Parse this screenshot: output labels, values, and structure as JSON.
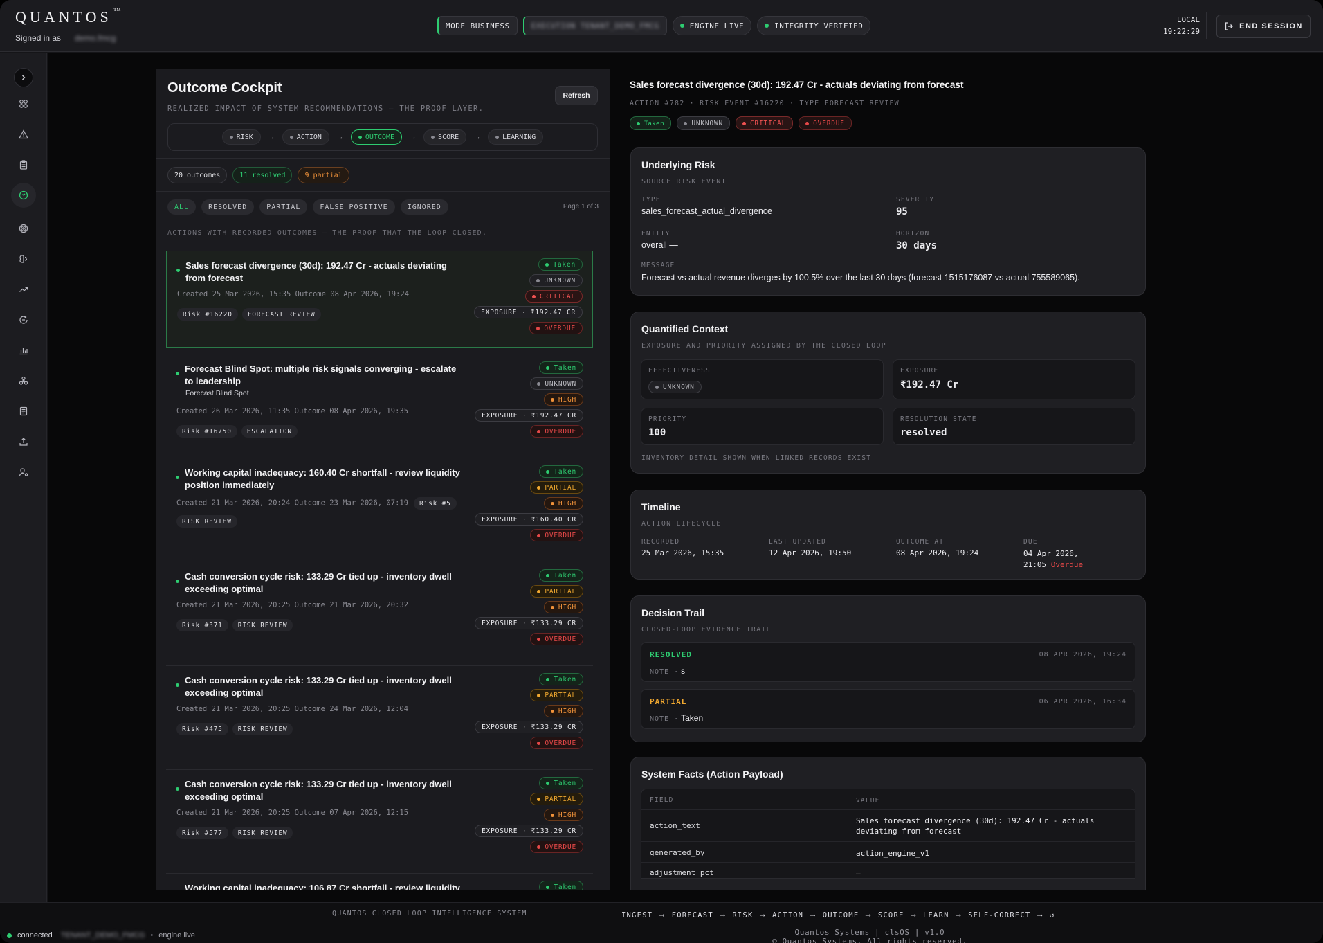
{
  "header": {
    "brand": "QUANTOS",
    "trademark": "™",
    "signed_in_label": "Signed in as",
    "user": "demo.fmcg",
    "pills": [
      "MODE BUSINESS",
      "EXECUTION TENANT_DEMO_FMCG",
      "ENGINE LIVE",
      "INTEGRITY VERIFIED"
    ],
    "local_label": "LOCAL",
    "time": "19:22:29",
    "end_session": "END SESSION"
  },
  "sidebar": {
    "icons": [
      "chevron-right-icon",
      "grid-icon",
      "alert-triangle-icon",
      "clipboard-icon",
      "clock-icon",
      "target-icon",
      "brain-icon",
      "trending-up-icon",
      "refresh-cycle-icon",
      "bar-chart-icon",
      "network-icon",
      "document-icon",
      "upload-icon",
      "user-settings-icon"
    ],
    "active_index": 4
  },
  "cockpit": {
    "title": "Outcome Cockpit",
    "subtitle": "REALIZED IMPACT OF SYSTEM RECOMMENDATIONS — THE PROOF LAYER.",
    "refresh": "Refresh",
    "flow": [
      "RISK",
      "ACTION",
      "OUTCOME",
      "SCORE",
      "LEARNING"
    ],
    "flow_active": "OUTCOME",
    "counts": {
      "total": "20 outcomes",
      "resolved": "11 resolved",
      "partial": "9 partial"
    },
    "filters": [
      "ALL",
      "RESOLVED",
      "PARTIAL",
      "FALSE POSITIVE",
      "IGNORED"
    ],
    "active_filter": "ALL",
    "page": "Page 1 of 3",
    "hint": "ACTIONS WITH RECORDED OUTCOMES — THE PROOF THAT THE LOOP CLOSED."
  },
  "cards": [
    {
      "title": "Sales forecast divergence (30d): 192.47 Cr - actuals deviating from forecast",
      "subtitle": "",
      "meta": "Created 25 Mar 2026, 15:35 Outcome 08 Apr 2026, 19:24",
      "tags": [
        "Risk #16220",
        "FORECAST REVIEW"
      ],
      "status": "Taken",
      "effect": "UNKNOWN",
      "effect_kind": "unk",
      "severity": "CRITICAL",
      "severity_kind": "crit",
      "exposure": "EXPOSURE · ₹192.47 CR",
      "due": "OVERDUE"
    },
    {
      "title": "Forecast Blind Spot: multiple risk signals converging - escalate to leadership",
      "subtitle": "Forecast Blind Spot",
      "meta": "Created 26 Mar 2026, 11:35 Outcome 08 Apr 2026, 19:35",
      "tags": [
        "Risk #16750",
        "ESCALATION"
      ],
      "status": "Taken",
      "effect": "UNKNOWN",
      "effect_kind": "unk",
      "severity": "HIGH",
      "severity_kind": "high",
      "exposure": "EXPOSURE · ₹192.47 CR",
      "due": "OVERDUE"
    },
    {
      "title": "Working capital inadequacy: 160.40 Cr shortfall - review liquidity position immediately",
      "subtitle": "",
      "meta": "Created 21 Mar 2026, 20:24 Outcome 23 Mar 2026, 07:19",
      "meta_tag": "Risk #5",
      "tags": [
        "RISK REVIEW"
      ],
      "status": "Taken",
      "effect": "PARTIAL",
      "effect_kind": "part",
      "severity": "HIGH",
      "severity_kind": "high",
      "exposure": "EXPOSURE · ₹160.40 CR",
      "due": "OVERDUE"
    },
    {
      "title": "Cash conversion cycle risk: 133.29 Cr tied up - inventory dwell exceeding optimal",
      "subtitle": "",
      "meta": "Created 21 Mar 2026, 20:25 Outcome 21 Mar 2026, 20:32",
      "tags": [
        "Risk #371",
        "RISK REVIEW"
      ],
      "status": "Taken",
      "effect": "PARTIAL",
      "effect_kind": "part",
      "severity": "HIGH",
      "severity_kind": "high",
      "exposure": "EXPOSURE · ₹133.29 CR",
      "due": "OVERDUE"
    },
    {
      "title": "Cash conversion cycle risk: 133.29 Cr tied up - inventory dwell exceeding optimal",
      "subtitle": "",
      "meta": "Created 21 Mar 2026, 20:25 Outcome 24 Mar 2026, 12:04",
      "tags": [
        "Risk #475",
        "RISK REVIEW"
      ],
      "status": "Taken",
      "effect": "PARTIAL",
      "effect_kind": "part",
      "severity": "HIGH",
      "severity_kind": "high",
      "exposure": "EXPOSURE · ₹133.29 CR",
      "due": "OVERDUE"
    },
    {
      "title": "Cash conversion cycle risk: 133.29 Cr tied up - inventory dwell exceeding optimal",
      "subtitle": "",
      "meta": "Created 21 Mar 2026, 20:25 Outcome 07 Apr 2026, 12:15",
      "tags": [
        "Risk #577",
        "RISK REVIEW"
      ],
      "status": "Taken",
      "effect": "PARTIAL",
      "effect_kind": "part",
      "severity": "HIGH",
      "severity_kind": "high",
      "exposure": "EXPOSURE · ₹133.29 CR",
      "due": "OVERDUE"
    },
    {
      "title": "Working capital inadequacy: 106.87 Cr shortfall - review liquidity",
      "subtitle": "",
      "meta": "",
      "tags": [],
      "status": "Taken",
      "effect": "",
      "effect_kind": "",
      "severity": "",
      "severity_kind": "",
      "exposure": "",
      "due": ""
    }
  ],
  "detail": {
    "title": "Sales forecast divergence (30d): 192.47 Cr - actuals deviating from forecast",
    "meta": "ACTION #782 · RISK EVENT #16220 · TYPE FORECAST_REVIEW",
    "badges": {
      "status": "Taken",
      "effect": "UNKNOWN",
      "severity": "CRITICAL",
      "due": "OVERDUE"
    },
    "risk": {
      "title": "Underlying Risk",
      "subtitle": "SOURCE RISK EVENT",
      "type_label": "TYPE",
      "type": "sales_forecast_actual_divergence",
      "severity_label": "SEVERITY",
      "severity": "95",
      "entity_label": "ENTITY",
      "entity": "overall —",
      "horizon_label": "HORIZON",
      "horizon": "30 days",
      "message_label": "MESSAGE",
      "message": "Forecast vs actual revenue diverges by 100.5% over the last 30 days (forecast 1515176087 vs actual 755589065)."
    },
    "context": {
      "title": "Quantified Context",
      "subtitle": "EXPOSURE AND PRIORITY ASSIGNED BY THE CLOSED LOOP",
      "effectiveness_label": "EFFECTIVENESS",
      "effectiveness": "UNKNOWN",
      "exposure_label": "EXPOSURE",
      "exposure": "₹192.47 Cr",
      "priority_label": "PRIORITY",
      "priority": "100",
      "resolution_label": "RESOLUTION STATE",
      "resolution": "resolved",
      "note": "INVENTORY DETAIL SHOWN WHEN LINKED RECORDS EXIST"
    },
    "timeline": {
      "title": "Timeline",
      "subtitle": "ACTION LIFECYCLE",
      "recorded_label": "RECORDED",
      "recorded": "25 Mar 2026, 15:35",
      "updated_label": "LAST UPDATED",
      "updated": "12 Apr 2026, 19:50",
      "outcome_label": "OUTCOME AT",
      "outcome": "08 Apr 2026, 19:24",
      "due_label": "DUE",
      "due_line1": "04 Apr 2026,",
      "due_line2": "21:05",
      "due_flag": "Overdue"
    },
    "trail": {
      "title": "Decision Trail",
      "subtitle": "CLOSED-LOOP EVIDENCE TRAIL",
      "entries": [
        {
          "state": "RESOLVED",
          "date": "08 APR 2026, 19:24",
          "note_label": "NOTE ·",
          "note": "s"
        },
        {
          "state": "PARTIAL",
          "date": "06 APR 2026, 16:34",
          "note_label": "NOTE ·",
          "note": "Taken"
        }
      ]
    },
    "facts": {
      "title": "System Facts (Action Payload)",
      "col_field": "FIELD",
      "col_value": "VALUE",
      "rows": [
        {
          "field": "action_text",
          "value": "Sales forecast divergence (30d): 192.47 Cr - actuals deviating from forecast"
        },
        {
          "field": "generated_by",
          "value": "action_engine_v1"
        },
        {
          "field": "adjustment_pct",
          "value": "—"
        }
      ]
    }
  },
  "footer": {
    "system": "QUANTOS CLOSED LOOP INTELLIGENCE SYSTEM",
    "chain": [
      "INGEST",
      "FORECAST",
      "RISK",
      "ACTION",
      "OUTCOME",
      "SCORE",
      "LEARN",
      "SELF-CORRECT"
    ],
    "chain_end": "↺",
    "copy1": "Quantos Systems | clsOS | v1.0",
    "copy2": "© Quantos Systems. All rights reserved.",
    "status": "connected",
    "tenant": "TENANT_DEMO_FMCG",
    "engine": "engine live"
  },
  "colors": {
    "accent": "#2ecc71",
    "critical": "#f05252",
    "high": "#f0923a",
    "partial": "#f0a830"
  }
}
